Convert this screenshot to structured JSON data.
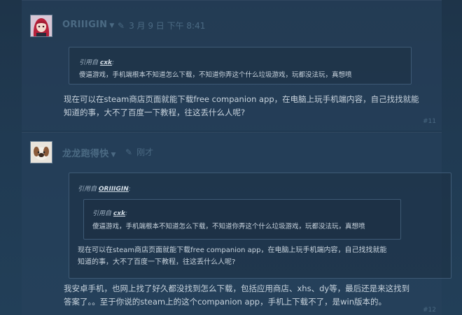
{
  "posts": [
    {
      "author": "ORIIIGIN",
      "timestamp": "3 月 9 日 下午 8:41",
      "quote": {
        "prefix": "引用自",
        "author": "cxk",
        "text": "傻逼游戏，手机端根本不知道怎么下载，不知道你弄这个什么垃圾游戏，玩都没法玩，真想喷"
      },
      "message_lines": [
        "现在可以在steam商店页面就能下载free companion app，在电脑上玩手机端内容，自己找找就能",
        "知道的事，大不了百度一下教程，往这丢什么人呢?"
      ],
      "number": "#11"
    },
    {
      "author": "龙龙跑得快",
      "timestamp": "刚才",
      "quote": {
        "prefix": "引用自",
        "author": "ORIIIGIN",
        "nested": {
          "prefix": "引用自",
          "author": "cxk",
          "text": "傻逼游戏，手机端根本不知道怎么下载，不知道你弄这个什么垃圾游戏，玩都没法玩，真想喷"
        },
        "text_lines": [
          "现在可以在steam商店页面就能下载free companion app，在电脑上玩手机端内容，自己找找就能",
          "知道的事，大不了百度一下教程，往这丢什么人呢?"
        ]
      },
      "message_lines": [
        "我安卓手机，也网上找了好久都没找到怎么下载，包括应用商店、xhs、dy等，最后还是来这找到",
        "答案了。。至于你说的steam上的这个companion app，手机上下载不了，是win版本的。"
      ],
      "number": "#12"
    }
  ]
}
